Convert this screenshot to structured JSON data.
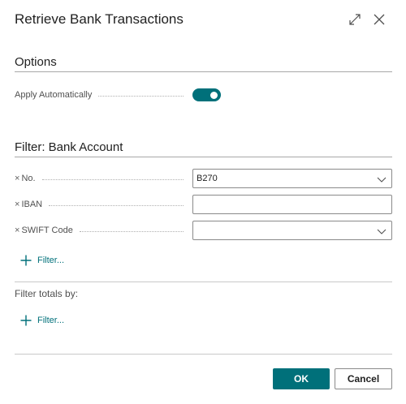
{
  "dialog": {
    "title": "Retrieve Bank Transactions"
  },
  "icons": {
    "expand": "expand-icon",
    "close": "close-icon",
    "chevron": "chevron-down-icon",
    "remove": "remove-filter-icon",
    "add": "plus-icon"
  },
  "colors": {
    "accent": "#00707a",
    "rule": "#a8a8a8",
    "text": "#212121"
  },
  "options": {
    "section_title": "Options",
    "apply_automatically": {
      "label": "Apply Automatically",
      "value": true
    }
  },
  "filter_bank_account": {
    "section_title": "Filter: Bank Account",
    "fields": [
      {
        "remove": "×",
        "label": "No.",
        "value": "B270",
        "type": "dropdown"
      },
      {
        "remove": "×",
        "label": "IBAN",
        "value": "",
        "type": "text"
      },
      {
        "remove": "×",
        "label": "SWIFT Code",
        "value": "",
        "type": "dropdown"
      }
    ],
    "add_filter_label": "Filter..."
  },
  "filter_totals": {
    "label": "Filter totals by:",
    "add_filter_label": "Filter..."
  },
  "footer": {
    "ok_label": "OK",
    "cancel_label": "Cancel"
  }
}
